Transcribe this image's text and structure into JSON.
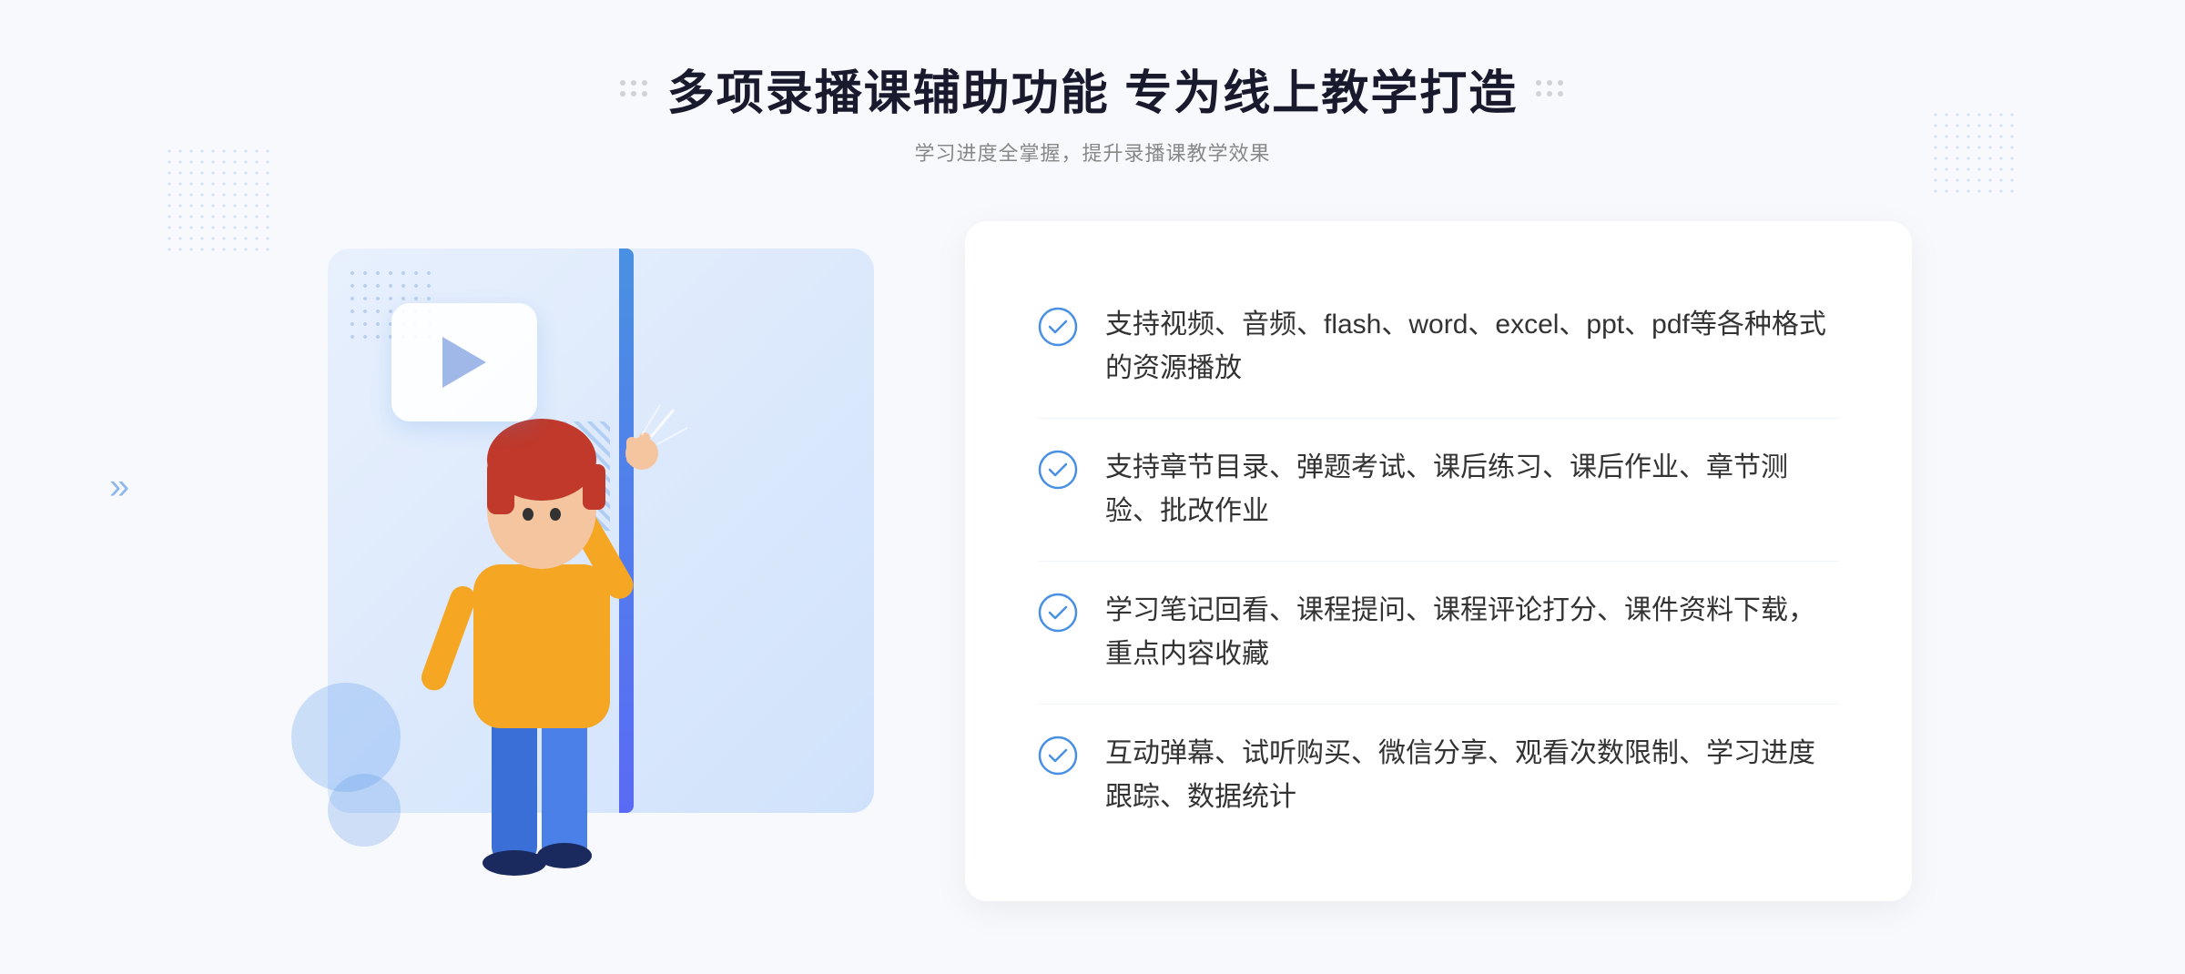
{
  "page": {
    "background": "#f8f9fc"
  },
  "header": {
    "title": "多项录播课辅助功能 专为线上教学打造",
    "subtitle": "学习进度全掌握，提升录播课教学效果",
    "decorator_left": "⁚",
    "decorator_right": "⁚"
  },
  "features": [
    {
      "id": 1,
      "text": "支持视频、音频、flash、word、excel、ppt、pdf等各种格式的资源播放"
    },
    {
      "id": 2,
      "text": "支持章节目录、弹题考试、课后练习、课后作业、章节测验、批改作业"
    },
    {
      "id": 3,
      "text": "学习笔记回看、课程提问、课程评论打分、课件资料下载，重点内容收藏"
    },
    {
      "id": 4,
      "text": "互动弹幕、试听购买、微信分享、观看次数限制、学习进度跟踪、数据统计"
    }
  ],
  "icons": {
    "check": "check-circle-icon",
    "play": "play-button-icon",
    "chevron_left": "»"
  },
  "colors": {
    "primary_blue": "#4a90e2",
    "accent_blue": "#5b6af5",
    "text_dark": "#1a1a2e",
    "text_light": "#888888",
    "text_feature": "#333333",
    "bg_light": "#f8f9fc",
    "card_bg": "#e8f0fd"
  }
}
